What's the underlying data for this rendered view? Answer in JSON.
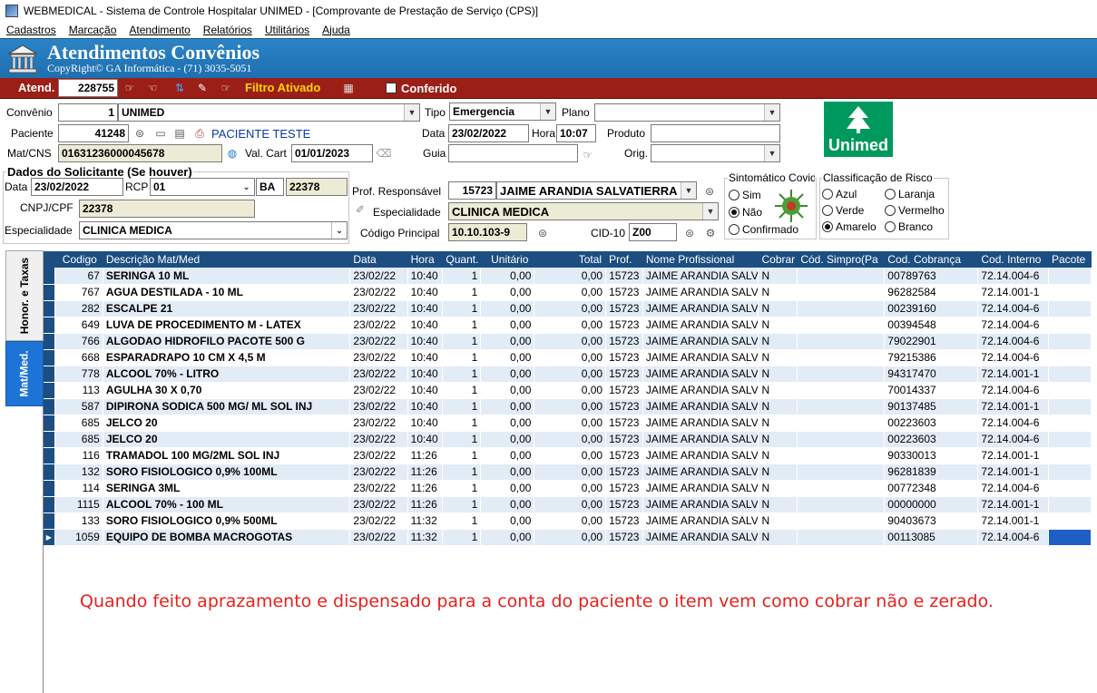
{
  "window": {
    "title": "WEBMEDICAL - Sistema de Controle Hospitalar UNIMED - [Comprovante de Prestação de Serviço  (CPS)]"
  },
  "menu": [
    "Cadastros",
    "Marcação",
    "Atendimento",
    "Relatórios",
    "Utilitários",
    "Ajuda"
  ],
  "banner": {
    "title": "Atendimentos Convênios",
    "subtitle": "CopyRight© GA Informática - (71) 3035-5051"
  },
  "toolbar": {
    "atend_label": "Atend.",
    "atend_value": "228755",
    "filter_status": "Filtro Ativado",
    "conferido_label": "Conferido",
    "conferido_checked": false
  },
  "form": {
    "convenio_label": "Convênio",
    "convenio_code": "1",
    "convenio_name": "UNIMED",
    "tipo_label": "Tipo",
    "tipo_value": "Emergencia",
    "plano_label": "Plano",
    "plano_value": "",
    "paciente_label": "Paciente",
    "paciente_code": "41248",
    "paciente_name": "PACIENTE TESTE",
    "data_label": "Data",
    "data_value": "23/02/2022",
    "hora_label": "Hora",
    "hora_value": "10:07",
    "produto_label": "Produto",
    "produto_value": "",
    "matcns_label": "Mat/CNS",
    "matcns_value": "01631236000045678",
    "valcart_label": "Val. Cart",
    "valcart_value": "01/01/2023",
    "guia_label": "Guia",
    "guia_value": "",
    "orig_label": "Orig.",
    "orig_value": ""
  },
  "solicitante": {
    "group_label": "Dados do Solicitante (Se houver)",
    "data_label": "Data",
    "data_value": "23/02/2022",
    "rcp_label": "RCP",
    "rcp_value": "01",
    "uf_value": "BA",
    "crm_value": "22378",
    "cnpj_label": "CNPJ/CPF",
    "cnpj_value": "22378",
    "especialidade_label": "Especialidade",
    "especialidade_value": "CLINICA MEDICA"
  },
  "profissional": {
    "prof_label": "Prof. Responsável",
    "prof_code": "15723",
    "prof_name": "JAIME ARANDIA SALVATIERRA",
    "especialidade_label": "Especialidade",
    "especialidade_value": "CLINICA MEDICA",
    "codigo_label": "Código Principal",
    "codigo_value": "10.10.103-9",
    "cid_label": "CID-10",
    "cid_value": "Z00"
  },
  "covid": {
    "group_label": "Sintomático Covid",
    "options": [
      "Sim",
      "Não",
      "Confirmado"
    ],
    "selected": "Não"
  },
  "risco": {
    "group_label": "Classificação de Risco",
    "options": [
      "Azul",
      "Laranja",
      "Verde",
      "Vermelho",
      "Amarelo",
      "Branco"
    ],
    "selected": "Amarelo"
  },
  "brand": {
    "logo_text": "Unimed",
    "color": "#00995d"
  },
  "tabs": [
    "Honor. e Taxas",
    "Mat/Med."
  ],
  "active_tab": "Mat/Med.",
  "grid": {
    "columns": [
      "Codigo",
      "Descrição Mat/Med",
      "Data",
      "Hora",
      "Quant.",
      "Unitário",
      "Total",
      "Prof.",
      "Nome Profissional",
      "Cobrar",
      "Cód. Simpro(Pa",
      "Cod. Cobrança",
      "Cod. Interno",
      "Pacote"
    ],
    "rows": [
      [
        "67",
        "SERINGA 10 ML",
        "23/02/22",
        "10:40",
        "1",
        "0,00",
        "0,00",
        "15723",
        "JAIME ARANDIA SALVA",
        "N",
        "",
        "00789763",
        "72.14.004-6",
        ""
      ],
      [
        "767",
        "AGUA DESTILADA - 10 ML",
        "23/02/22",
        "10:40",
        "1",
        "0,00",
        "0,00",
        "15723",
        "JAIME ARANDIA SALVA",
        "N",
        "",
        "96282584",
        "72.14.001-1",
        ""
      ],
      [
        "282",
        "ESCALPE 21",
        "23/02/22",
        "10:40",
        "1",
        "0,00",
        "0,00",
        "15723",
        "JAIME ARANDIA SALVA",
        "N",
        "",
        "00239160",
        "72.14.004-6",
        ""
      ],
      [
        "649",
        "LUVA DE PROCEDIMENTO M - LATEX",
        "23/02/22",
        "10:40",
        "1",
        "0,00",
        "0,00",
        "15723",
        "JAIME ARANDIA SALVA",
        "N",
        "",
        "00394548",
        "72.14.004-6",
        ""
      ],
      [
        "766",
        "ALGODAO HIDROFILO PACOTE 500 G",
        "23/02/22",
        "10:40",
        "1",
        "0,00",
        "0,00",
        "15723",
        "JAIME ARANDIA SALVA",
        "N",
        "",
        "79022901",
        "72.14.004-6",
        ""
      ],
      [
        "668",
        "ESPARADRAPO 10 CM X 4,5 M",
        "23/02/22",
        "10:40",
        "1",
        "0,00",
        "0,00",
        "15723",
        "JAIME ARANDIA SALVA",
        "N",
        "",
        "79215386",
        "72.14.004-6",
        ""
      ],
      [
        "778",
        "ALCOOL 70% - LITRO",
        "23/02/22",
        "10:40",
        "1",
        "0,00",
        "0,00",
        "15723",
        "JAIME ARANDIA SALVA",
        "N",
        "",
        "94317470",
        "72.14.001-1",
        ""
      ],
      [
        "113",
        "AGULHA 30 X 0,70",
        "23/02/22",
        "10:40",
        "1",
        "0,00",
        "0,00",
        "15723",
        "JAIME ARANDIA SALVA",
        "N",
        "",
        "70014337",
        "72.14.004-6",
        ""
      ],
      [
        "587",
        "DIPIRONA SODICA 500 MG/ ML SOL INJ",
        "23/02/22",
        "10:40",
        "1",
        "0,00",
        "0,00",
        "15723",
        "JAIME ARANDIA SALVA",
        "N",
        "",
        "90137485",
        "72.14.001-1",
        ""
      ],
      [
        "685",
        "JELCO 20",
        "23/02/22",
        "10:40",
        "1",
        "0,00",
        "0,00",
        "15723",
        "JAIME ARANDIA SALVA",
        "N",
        "",
        "00223603",
        "72.14.004-6",
        ""
      ],
      [
        "685",
        "JELCO 20",
        "23/02/22",
        "10:40",
        "1",
        "0,00",
        "0,00",
        "15723",
        "JAIME ARANDIA SALVA",
        "N",
        "",
        "00223603",
        "72.14.004-6",
        ""
      ],
      [
        "116",
        "TRAMADOL 100 MG/2ML SOL INJ",
        "23/02/22",
        "11:26",
        "1",
        "0,00",
        "0,00",
        "15723",
        "JAIME ARANDIA SALVA",
        "N",
        "",
        "90330013",
        "72.14.001-1",
        ""
      ],
      [
        "132",
        "SORO FISIOLOGICO 0,9% 100ML",
        "23/02/22",
        "11:26",
        "1",
        "0,00",
        "0,00",
        "15723",
        "JAIME ARANDIA SALVA",
        "N",
        "",
        "96281839",
        "72.14.001-1",
        ""
      ],
      [
        "114",
        "SERINGA 3ML",
        "23/02/22",
        "11:26",
        "1",
        "0,00",
        "0,00",
        "15723",
        "JAIME ARANDIA SALVA",
        "N",
        "",
        "00772348",
        "72.14.004-6",
        ""
      ],
      [
        "1115",
        "ALCOOL 70% - 100 ML",
        "23/02/22",
        "11:26",
        "1",
        "0,00",
        "0,00",
        "15723",
        "JAIME ARANDIA SALVA",
        "N",
        "",
        "00000000",
        "72.14.001-1",
        ""
      ],
      [
        "133",
        "SORO FISIOLOGICO 0,9% 500ML",
        "23/02/22",
        "11:32",
        "1",
        "0,00",
        "0,00",
        "15723",
        "JAIME ARANDIA SALVA",
        "N",
        "",
        "90403673",
        "72.14.001-1",
        ""
      ],
      [
        "1059",
        "EQUIPO DE BOMBA MACROGOTAS",
        "23/02/22",
        "11:32",
        "1",
        "0,00",
        "0,00",
        "15723",
        "JAIME ARANDIA SALVA",
        "N",
        "",
        "00113085",
        "72.14.004-6",
        ""
      ]
    ],
    "current_row": 16
  },
  "note": "Quando feito aprazamento e dispensado para a conta do paciente o item vem como cobrar não e zerado.",
  "colors": {
    "banner": "#1e6fb0",
    "toolbar": "#9b1f17",
    "filter_text": "#ffd400",
    "grid_header": "#1d4e82",
    "note_text": "#e8211c"
  }
}
